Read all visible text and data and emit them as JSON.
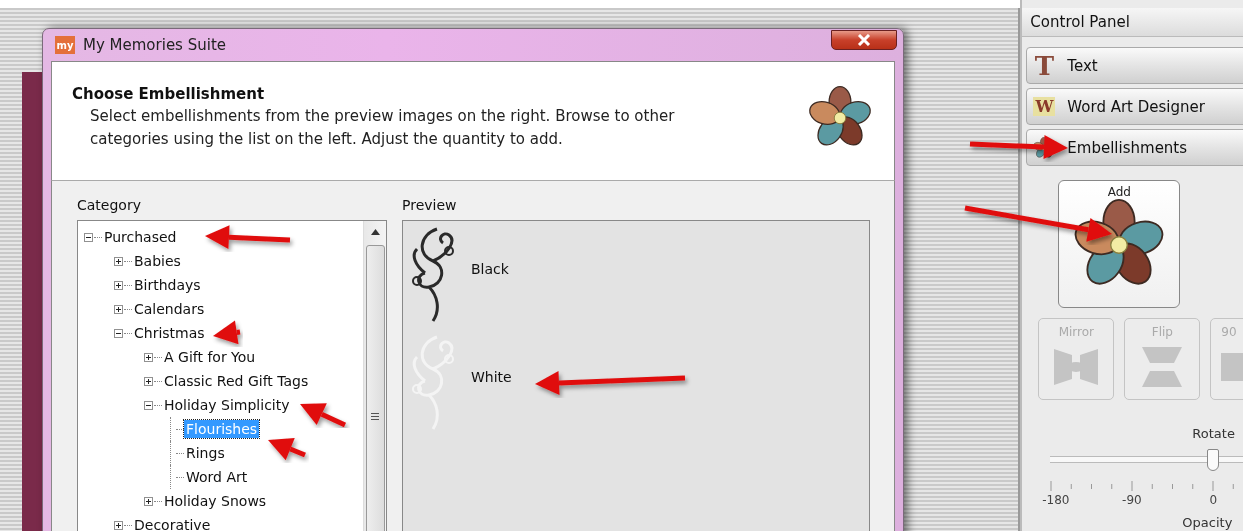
{
  "window": {
    "app_icon_text": "my",
    "title": "My Memories Suite"
  },
  "header": {
    "title": "Choose Embellishment",
    "description": "Select embellishments from the preview images on the right. Browse to other categories using the list on the left. Adjust the quantity to add."
  },
  "category": {
    "label": "Category",
    "tree": [
      {
        "label": "Purchased",
        "expanded": true,
        "selected": false,
        "children": [
          {
            "label": "Babies",
            "expanded": false,
            "selected": false
          },
          {
            "label": "Birthdays",
            "expanded": false,
            "selected": false
          },
          {
            "label": "Calendars",
            "expanded": false,
            "selected": false
          },
          {
            "label": "Christmas",
            "expanded": true,
            "selected": false,
            "children": [
              {
                "label": "A Gift for You",
                "expanded": false,
                "selected": false
              },
              {
                "label": "Classic Red Gift Tags",
                "expanded": false,
                "selected": false
              },
              {
                "label": "Holiday Simplicity",
                "expanded": true,
                "selected": false,
                "children": [
                  {
                    "label": "Flourishes",
                    "selected": true
                  },
                  {
                    "label": "Rings",
                    "selected": false
                  },
                  {
                    "label": "Word Art",
                    "selected": false
                  }
                ]
              },
              {
                "label": "Holiday Snows",
                "expanded": false,
                "selected": false
              }
            ]
          },
          {
            "label": "Decorative",
            "expanded": false,
            "selected": false
          }
        ]
      }
    ]
  },
  "preview": {
    "label": "Preview",
    "items": [
      {
        "label": "Black",
        "color": "#2a2a2a"
      },
      {
        "label": "White",
        "color": "#f4f4f4"
      }
    ]
  },
  "control_panel": {
    "title": "Control Panel",
    "sections": [
      {
        "kind": "text",
        "label": "Text",
        "icon_letter": "T"
      },
      {
        "kind": "wordart",
        "label": "Word Art Designer",
        "icon_letter": "W"
      },
      {
        "kind": "embellish",
        "label": "Embellishments"
      }
    ],
    "add_button": {
      "label": "Add"
    },
    "tools": [
      {
        "kind": "mirror",
        "label": "Mirror",
        "disabled": true
      },
      {
        "kind": "flip",
        "label": "Flip",
        "disabled": true
      },
      {
        "kind": "rotate90",
        "label": "90",
        "disabled": true
      }
    ],
    "rotate": {
      "label": "Rotate",
      "level": 0.5,
      "tick_labels": [
        "-180",
        "-90",
        "0"
      ]
    },
    "opacity": {
      "label": "Opacity"
    }
  }
}
